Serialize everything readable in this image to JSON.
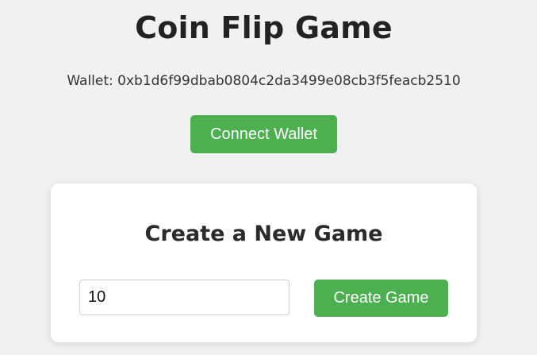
{
  "header": {
    "title": "Coin Flip Game",
    "wallet_text": "Wallet: 0xb1d6f99dbab0804c2da3499e08cb3f5feacb2510"
  },
  "connect": {
    "button_label": "Connect Wallet"
  },
  "create_game": {
    "title": "Create a New Game",
    "amount_value": "10",
    "button_label": "Create Game"
  },
  "colors": {
    "accent": "#4caf50",
    "background": "#f1f1f1",
    "card": "#ffffff"
  }
}
